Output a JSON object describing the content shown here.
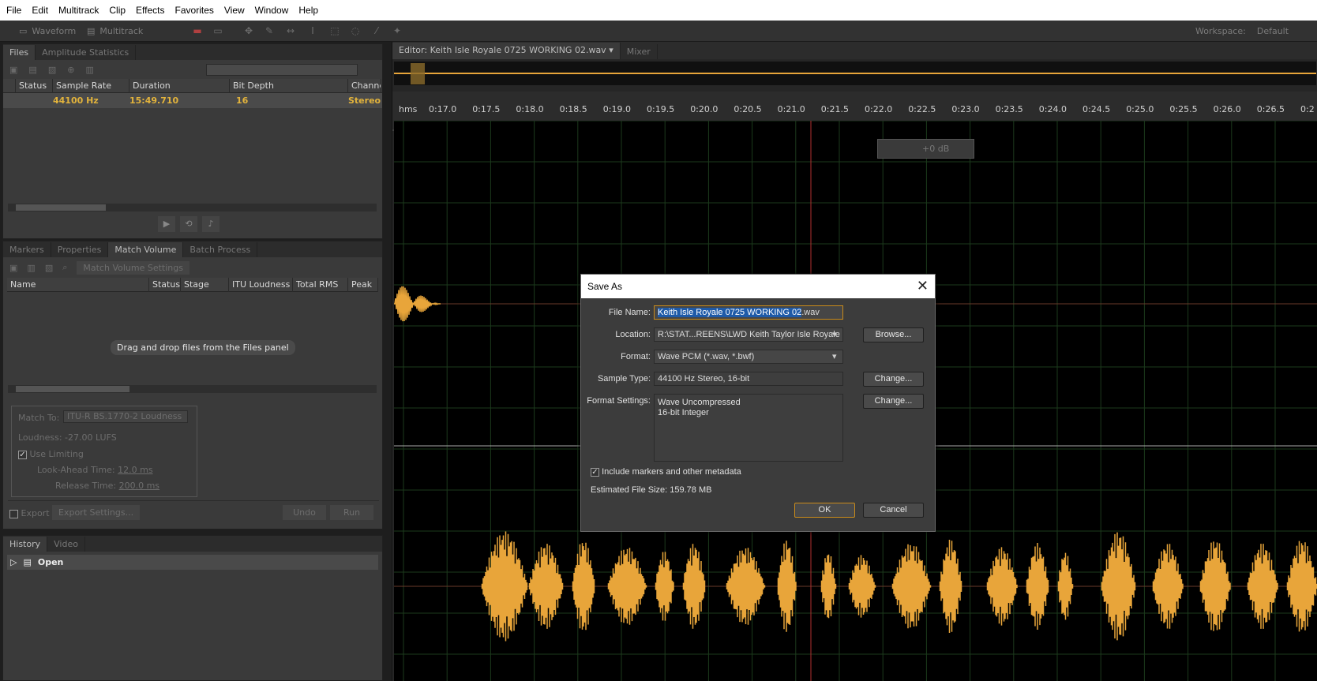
{
  "menu": [
    "File",
    "Edit",
    "Multitrack",
    "Clip",
    "Effects",
    "Favorites",
    "View",
    "Window",
    "Help"
  ],
  "toolbar": {
    "waveform": "Waveform",
    "multitrack": "Multitrack",
    "workspace_label": "Workspace:",
    "workspace_value": "Default"
  },
  "files_panel": {
    "tabs": [
      "Files",
      "Amplitude Statistics"
    ],
    "columns": [
      "Status",
      "Sample Rate",
      "Duration",
      "Bit Depth",
      "Channe"
    ],
    "row": {
      "status": "",
      "sample_rate": "44100 Hz",
      "duration": "15:49.710",
      "bit_depth": "16",
      "channels": "Stereo"
    }
  },
  "match_panel": {
    "tabs": [
      "Markers",
      "Properties",
      "Match Volume",
      "Batch Process"
    ],
    "settings_btn": "Match Volume Settings",
    "columns": [
      "Name",
      "Status",
      "Stage",
      "ITU Loudness",
      "Total RMS",
      "Peak"
    ],
    "drop_hint": "Drag and drop files from the Files panel",
    "match_to_label": "Match To:",
    "match_to_value": "ITU-R BS.1770-2 Loudness",
    "loudness": "Loudness: -27.00 LUFS",
    "use_limiting": "Use Limiting",
    "lookahead_label": "Look-Ahead Time:",
    "lookahead_value": "12.0 ms",
    "release_label": "Release Time:",
    "release_value": "200.0 ms",
    "export": "Export",
    "export_settings": "Export Settings...",
    "undo": "Undo",
    "run": "Run"
  },
  "history_panel": {
    "tabs": [
      "History",
      "Video"
    ],
    "item": "Open"
  },
  "editor": {
    "tab": "Editor: Keith Isle Royale 0725 WORKING 02.wav",
    "mixer_tab": "Mixer",
    "ruler_unit": "hms",
    "ruler_labels": [
      "0:17.0",
      "0:17.5",
      "0:18.0",
      "0:18.5",
      "0:19.0",
      "0:19.5",
      "0:20.0",
      "0:20.5",
      "0:21.0",
      "0:21.5",
      "0:22.0",
      "0:22.5",
      "0:23.0",
      "0:23.5",
      "0:24.0",
      "0:24.5",
      "0:25.0",
      "0:25.5",
      "0:26.0",
      "0:26.5",
      "0:2"
    ],
    "hud_gain": "+0 dB"
  },
  "dialog": {
    "title": "Save As",
    "file_name_label": "File Name:",
    "file_name_selected": "Keith Isle Royale 0725 WORKING 02",
    "file_name_ext": ".wav",
    "location_label": "Location:",
    "location_value": "R:\\STAT...REENS\\LWD Keith Taylor Isle Royale",
    "browse": "Browse...",
    "format_label": "Format:",
    "format_value": "Wave PCM (*.wav, *.bwf)",
    "sample_type_label": "Sample Type:",
    "sample_type_value": "44100 Hz Stereo, 16-bit",
    "change1": "Change...",
    "format_settings_label": "Format Settings:",
    "format_settings_line1": "Wave Uncompressed",
    "format_settings_line2": "16-bit Integer",
    "change2": "Change...",
    "include_markers": "Include markers and other metadata",
    "estimated_size": "Estimated File Size: 159.78 MB",
    "ok": "OK",
    "cancel": "Cancel"
  },
  "colors": {
    "waveform": "#e8a53a",
    "selection": "#1e5aa8",
    "accent": "#e2b33c"
  }
}
